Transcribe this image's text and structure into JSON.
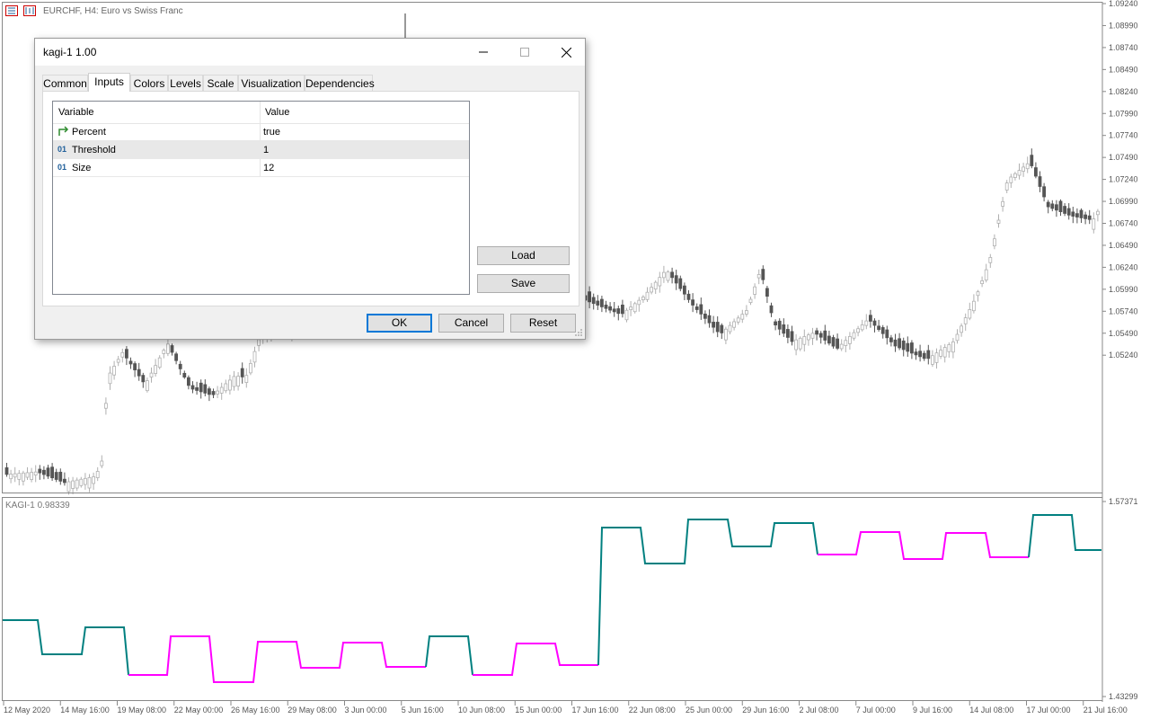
{
  "chart": {
    "symbol_text": "EURCHF, H4:  Euro vs Swiss Franc",
    "price_axis": [
      "1.09240",
      "1.08990",
      "1.08740",
      "1.08490",
      "1.08240",
      "1.07990",
      "1.07740",
      "1.07490",
      "1.07240",
      "1.06990",
      "1.06740",
      "1.06490",
      "1.06240",
      "1.05990",
      "1.05740",
      "1.05490",
      "1.05240"
    ],
    "time_axis": [
      "12 May 2020",
      "14 May 16:00",
      "19 May 08:00",
      "22 May 00:00",
      "26 May 16:00",
      "29 May 08:00",
      "3 Jun 00:00",
      "5 Jun 16:00",
      "10 Jun 08:00",
      "15 Jun 00:00",
      "17 Jun 16:00",
      "22 Jun 08:00",
      "25 Jun 00:00",
      "29 Jun 16:00",
      "2 Jul 08:00",
      "7 Jul 00:00",
      "9 Jul 16:00",
      "14 Jul 08:00",
      "17 Jul 00:00",
      "21 Jul 16:00"
    ],
    "indicator_label": "KAGI-1 0.98339",
    "indicator_axis": {
      "top": "1.57371",
      "bottom": "1.43299"
    },
    "colors": {
      "yang": "#008080",
      "yin": "#ff00ff",
      "candle": "#555555",
      "candle_light": "#b0b0b0"
    }
  },
  "dialog": {
    "title": "kagi-1 1.00",
    "tabs": [
      "Common",
      "Inputs",
      "Colors",
      "Levels",
      "Scale",
      "Visualization",
      "Dependencies"
    ],
    "active_tab": "Inputs",
    "columns": {
      "variable": "Variable",
      "value": "Value"
    },
    "rows": [
      {
        "icon": "bool-icon",
        "name": "Percent",
        "value": "true"
      },
      {
        "icon": "int-icon",
        "icon_text": "01",
        "name": "Threshold",
        "value": "1"
      },
      {
        "icon": "int-icon",
        "icon_text": "01",
        "name": "Size",
        "value": "12"
      }
    ],
    "buttons": {
      "load": "Load",
      "save": "Save",
      "ok": "OK",
      "cancel": "Cancel",
      "reset": "Reset"
    }
  }
}
